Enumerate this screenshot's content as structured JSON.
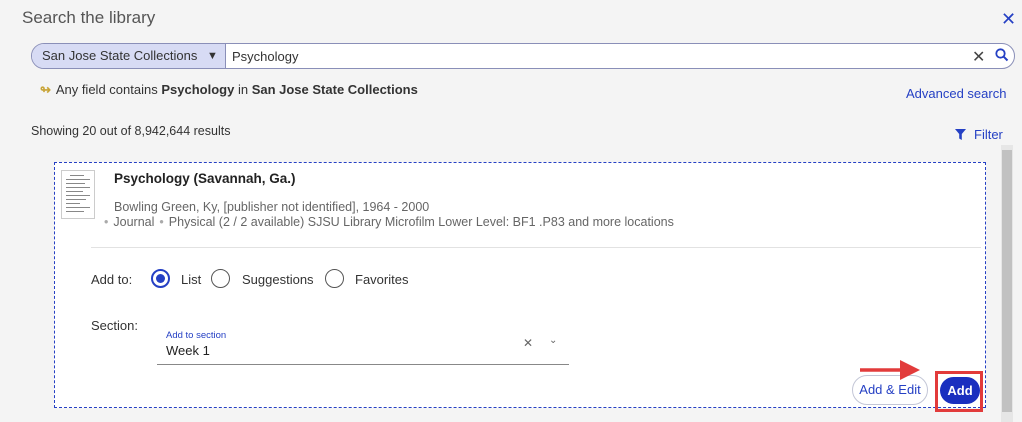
{
  "dialog": {
    "title": "Search the library",
    "close_icon": "close-icon"
  },
  "search": {
    "scope": "San Jose State Collections",
    "query": "Psychology",
    "clear_icon": "clear-icon",
    "submit_icon": "search-icon"
  },
  "summary": {
    "prefix": "Any field contains",
    "term": "Psychology",
    "in_word": "in",
    "collection": "San Jose State Collections",
    "advanced_label": "Advanced search"
  },
  "results": {
    "showing": "Showing 20 out of 8,942,644 results",
    "filter_label": "Filter"
  },
  "record": {
    "title": "Psychology (Savannah, Ga.)",
    "publication": "Bowling Green, Ky, [publisher not identified], 1964 - 2000",
    "type": "Journal",
    "availability": "Physical (2 / 2 available) SJSU Library Microfilm Lower Level: BF1 .P83 and more locations"
  },
  "add_form": {
    "add_to_label": "Add to:",
    "options": [
      "List",
      "Suggestions",
      "Favorites"
    ],
    "selected_option": "List",
    "section_label": "Section:",
    "section_float_label": "Add to section",
    "section_value": "Week 1",
    "add_edit_label": "Add & Edit",
    "add_label": "Add"
  },
  "colors": {
    "accent": "#2540c4",
    "add_button": "#1a2fbf",
    "highlight": "#e23b3b"
  }
}
